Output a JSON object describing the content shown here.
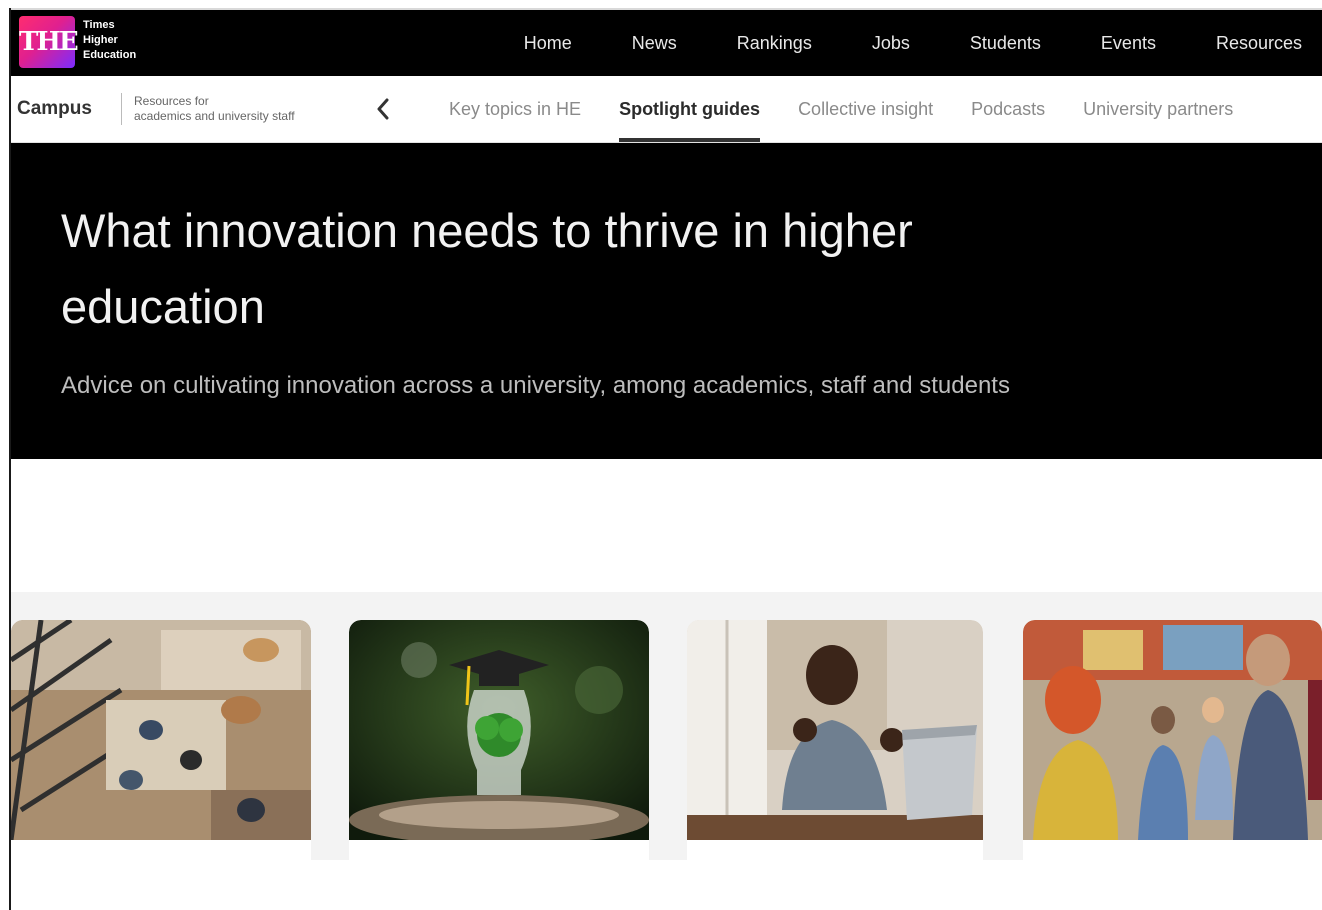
{
  "brand": {
    "logo_mark": "THE",
    "logo_lines": [
      "Times",
      "Higher",
      "Education"
    ],
    "gradient": [
      "#ff2d6f",
      "#7b2cff"
    ]
  },
  "topnav": {
    "items": [
      "Home",
      "News",
      "Rankings",
      "Jobs",
      "Students",
      "Events",
      "Resources"
    ]
  },
  "subnav": {
    "section": "Campus",
    "description_lines": [
      "Resources for",
      "academics and university staff"
    ],
    "back_icon": "chevron-left-icon",
    "tabs": [
      "Key topics in HE",
      "Spotlight guides",
      "Collective insight",
      "Podcasts",
      "University partners"
    ],
    "active_tab": "Spotlight guides"
  },
  "hero": {
    "title": "What innovation needs to thrive in higher education",
    "subtitle": "Advice on cultivating innovation across a university, among academics, staff and students"
  },
  "cards": [
    {
      "image": "overhead-office-workspace"
    },
    {
      "image": "lightbulb-with-graduation-cap-and-plant"
    },
    {
      "image": "student-celebrating-at-laptop"
    },
    {
      "image": "group-workshop-discussion"
    }
  ]
}
